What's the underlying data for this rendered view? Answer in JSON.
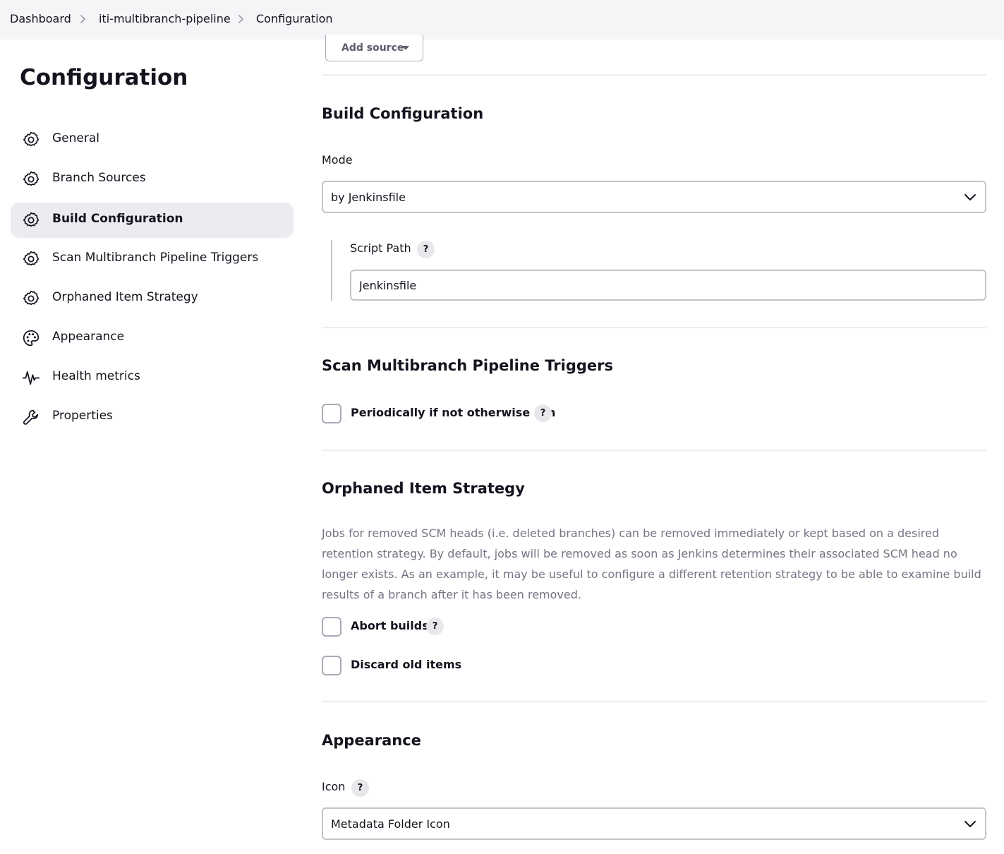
{
  "breadcrumb": [
    "Dashboard",
    "iti-multibranch-pipeline",
    "Configuration"
  ],
  "sidebar": {
    "title": "Configuration",
    "items": [
      {
        "label": "General",
        "icon": "gear-icon"
      },
      {
        "label": "Branch Sources",
        "icon": "gear-icon"
      },
      {
        "label": "Build Configuration",
        "icon": "gear-icon",
        "active": true
      },
      {
        "label": "Scan Multibranch Pipeline Triggers",
        "icon": "gear-icon"
      },
      {
        "label": "Orphaned Item Strategy",
        "icon": "gear-icon"
      },
      {
        "label": "Appearance",
        "icon": "palette-icon"
      },
      {
        "label": "Health metrics",
        "icon": "pulse-icon"
      },
      {
        "label": "Properties",
        "icon": "wrench-icon"
      }
    ]
  },
  "branch_sources": {
    "add_source_label": "Add source"
  },
  "build_configuration": {
    "title": "Build Configuration",
    "mode_label": "Mode",
    "mode_value": "by Jenkinsfile",
    "script_path_label": "Script Path",
    "script_path_value": "Jenkinsfile"
  },
  "triggers": {
    "title": "Scan Multibranch Pipeline Triggers",
    "periodic_label": "Periodically if not otherwise run",
    "periodic_checked": false
  },
  "orphaned": {
    "title": "Orphaned Item Strategy",
    "description": "Jobs for removed SCM heads (i.e. deleted branches) can be removed immediately or kept based on a desired retention strategy. By default, jobs will be removed as soon as Jenkins determines their associated SCM head no longer exists. As an example, it may be useful to configure a different retention strategy to be able to examine build results of a branch after it has been removed.",
    "abort_builds_label": "Abort builds",
    "abort_builds_checked": false,
    "discard_old_label": "Discard old items",
    "discard_old_checked": false
  },
  "appearance": {
    "title": "Appearance",
    "icon_label": "Icon",
    "icon_value": "Metadata Folder Icon"
  },
  "help_label": "?",
  "colors": {
    "active_nav_bg": "#ebecf0",
    "breadcrumb_bg": "#f5f5f7",
    "text": "#14141f",
    "muted_text": "#737584"
  }
}
